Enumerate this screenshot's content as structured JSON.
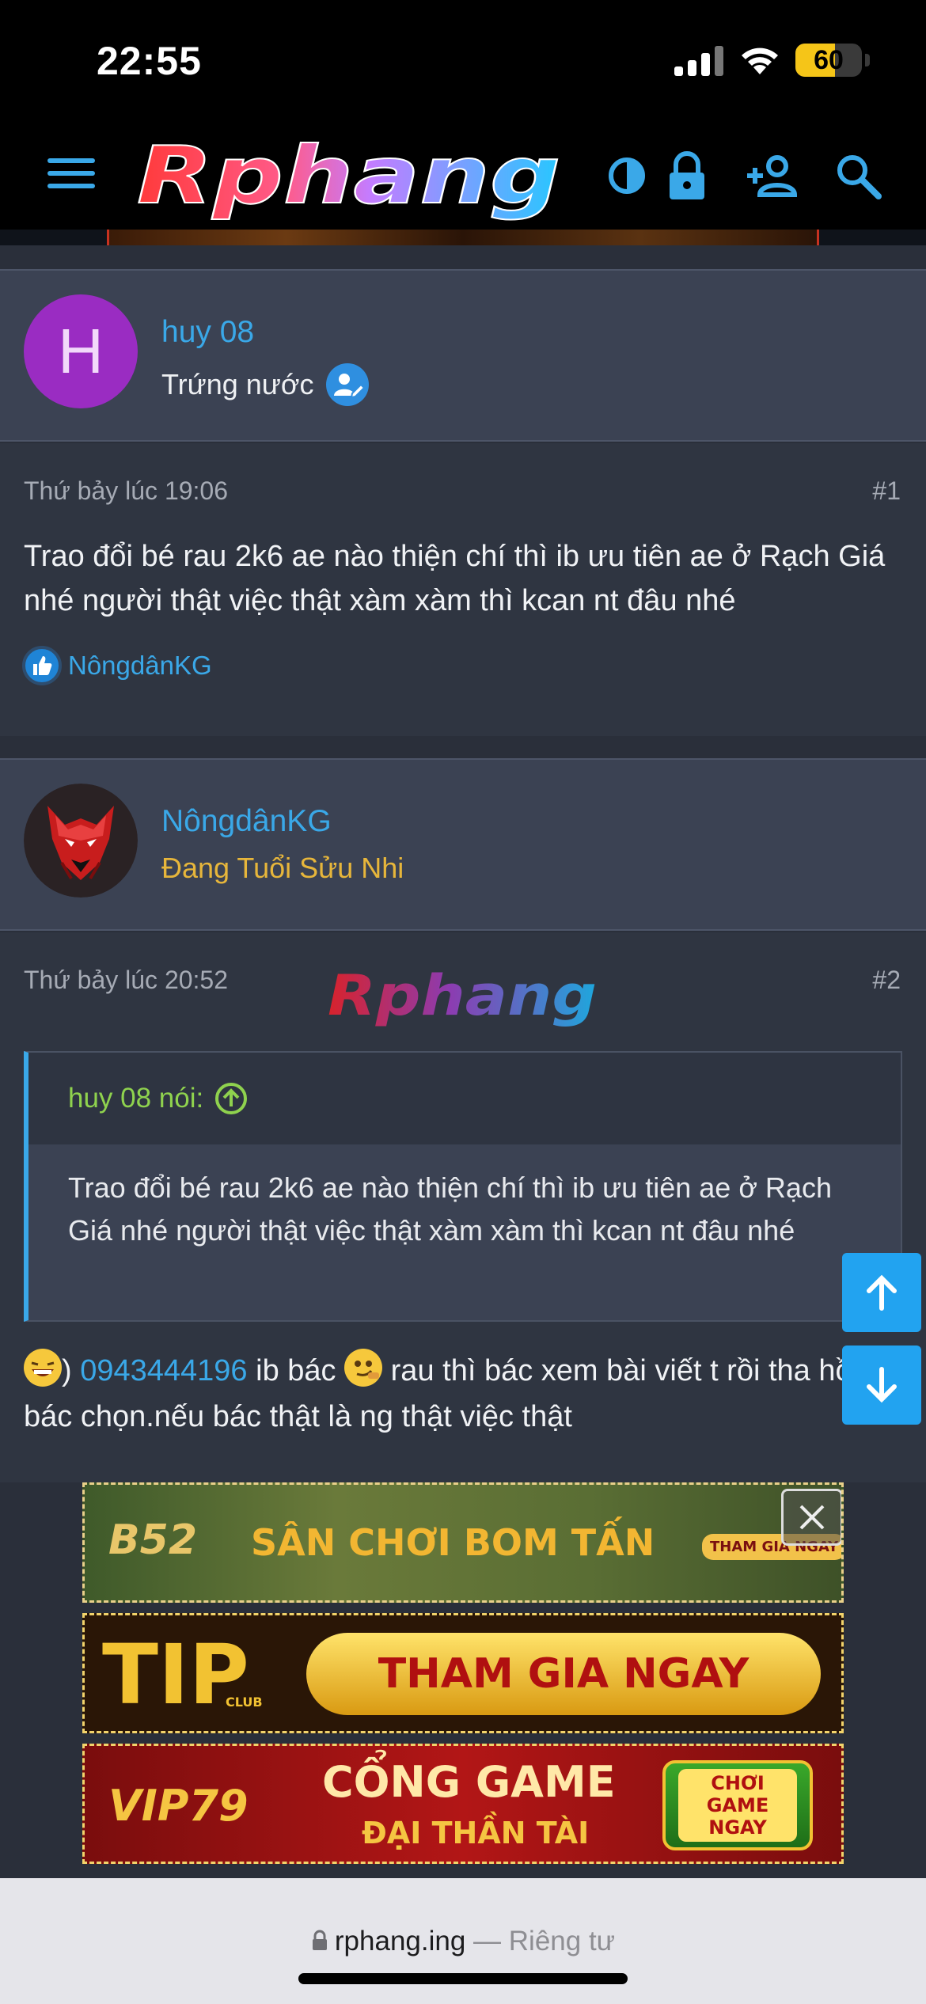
{
  "status": {
    "time": "22:55",
    "battery": "60",
    "battery_level": 0.6
  },
  "header": {
    "logo": "Rphang",
    "icons": [
      "menu-icon",
      "theme-toggle-icon",
      "lock-icon",
      "register-icon",
      "search-icon"
    ]
  },
  "posts": [
    {
      "author": "huy 08",
      "avatar_letter": "H",
      "user_title": "Trứng nước",
      "date": "Thứ bảy lúc 19:06",
      "number": "#1",
      "text": "Trao đổi bé rau 2k6 ae nào thiện chí thì ib ưu tiên ae ở Rạch Giá nhé người thật việc thật xàm xàm thì kcan nt đâu nhé",
      "reaction_user": "NôngdânKG"
    },
    {
      "author": "NôngdânKG",
      "user_title": "Đang Tuổi Sửu Nhi",
      "date": "Thứ bảy lúc 20:52",
      "number": "#2",
      "watermark": "Rphang",
      "quote_author": "huy 08 nói:",
      "quote_text": "Trao đổi bé rau 2k6 ae nào thiện chí thì ib ưu tiên ae ở Rạch Giá nhé người thật việc thật xàm xàm thì kcan nt đâu nhé",
      "reply_prefix": ")",
      "reply_phone": "0943444196",
      "reply_mid": " ib bác ",
      "reply_tail": " rau thì bác xem bài viết t rồi tha hồ bác chọn.nếu bác thật là ng thật việc thật"
    }
  ],
  "ads": [
    {
      "brand": "B52",
      "text": "SÂN CHƠI BOM TẤN",
      "cta": "THAM GIA NGAY"
    },
    {
      "brand": "TIP",
      "brand_sub": "CLUB",
      "text": "THAM GIA NGAY"
    },
    {
      "brand": "VIP79",
      "text": "CỔNG GAME",
      "text2": "ĐẠI THẦN TÀI",
      "cta": "CHƠI GAME NGAY"
    }
  ],
  "browser": {
    "domain": "rphang.ing",
    "privacy": "— Riêng tư"
  },
  "colors": {
    "accent": "#3aa8e8",
    "quote_green": "#8fd24e",
    "rank_gold": "#e7b63b",
    "scroll_button": "#22a3f0"
  }
}
